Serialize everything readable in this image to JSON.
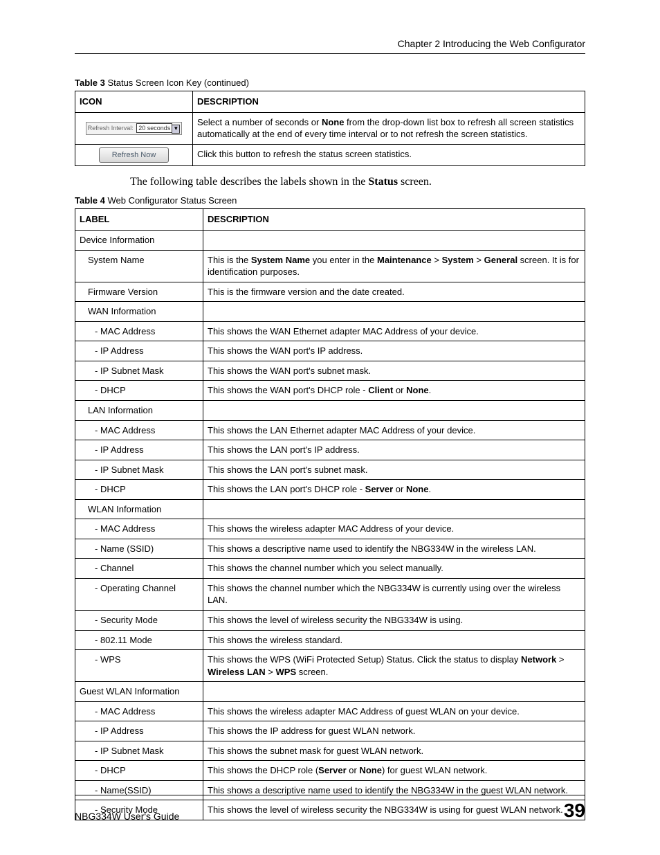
{
  "chapter_header": "Chapter 2 Introducing the Web Configurator",
  "table3": {
    "caption_prefix": "Table 3",
    "caption_body": "   Status Screen Icon Key  (continued)",
    "head_icon": "ICON",
    "head_desc": "DESCRIPTION",
    "refresh_interval_label": "Refresh Interval:",
    "refresh_interval_value": "20 seconds",
    "row1_desc_1": "Select a number of seconds or ",
    "row1_desc_bold": "None",
    "row1_desc_2": " from the drop-down list box to refresh all screen statistics automatically at the end of every time interval or to not refresh the screen statistics.",
    "refresh_now_label": "Refresh Now",
    "row2_desc": "Click this button to refresh the status screen statistics."
  },
  "intro_1": "The following table describes the labels shown in the ",
  "intro_bold": "Status",
  "intro_2": " screen.",
  "table4": {
    "caption_prefix": "Table 4",
    "caption_body": "   Web Configurator Status Screen",
    "head_label": "LABEL",
    "head_desc": "DESCRIPTION",
    "r1_l": "Device Information",
    "r1_d": "",
    "r2_l": "System Name",
    "r2_d_1": "This is the ",
    "r2_d_b1": "System Name",
    "r2_d_2": " you enter in the ",
    "r2_d_b2": "Maintenance",
    "r2_gt": " > ",
    "r2_d_b3": "System",
    "r2_d_b4": "General",
    "r2_d_3": " screen. It is for identification purposes.",
    "r3_l": "Firmware Version",
    "r3_d": "This is the firmware version and the date created.",
    "r4_l": "WAN Information",
    "r4_d": "",
    "r5_l": "- MAC Address",
    "r5_d": "This shows the WAN Ethernet adapter MAC Address of your device.",
    "r6_l": "- IP Address",
    "r6_d": "This shows the WAN port's IP address.",
    "r7_l": "- IP Subnet Mask",
    "r7_d": "This shows the WAN port's subnet mask.",
    "r8_l": "- DHCP",
    "r8_d_1": "This shows the WAN port's DHCP role - ",
    "r8_d_b1": "Client",
    "r8_d_2": " or ",
    "r8_d_b2": "None",
    "r8_d_3": ".",
    "r9_l": "LAN Information",
    "r9_d": "",
    "r10_l": "- MAC Address",
    "r10_d": "This shows the LAN Ethernet adapter MAC Address of your device.",
    "r11_l": "- IP Address",
    "r11_d": "This shows the LAN port's IP address.",
    "r12_l": "- IP Subnet Mask",
    "r12_d": "This shows the LAN port's subnet mask.",
    "r13_l": "- DHCP",
    "r13_d_1": "This shows the LAN port's DHCP role - ",
    "r13_d_b1": "Server",
    "r13_d_2": " or ",
    "r13_d_b2": "None",
    "r13_d_3": ".",
    "r14_l": "WLAN Information",
    "r14_d": "",
    "r15_l": "- MAC Address",
    "r15_d": "This shows the wireless adapter MAC Address of your device.",
    "r16_l": "- Name (SSID)",
    "r16_d": "This shows a descriptive name used to identify the NBG334W in the wireless LAN.",
    "r17_l": "- Channel",
    "r17_d": "This shows the channel number which you select manually.",
    "r18_l": "- Operating Channel",
    "r18_d": "This shows the channel number which the NBG334W is currently using over the wireless LAN.",
    "r19_l": "- Security Mode",
    "r19_d": "This shows the level of wireless security the NBG334W is using.",
    "r20_l": "- 802.11 Mode",
    "r20_d": "This shows the wireless standard.",
    "r21_l": "- WPS",
    "r21_d_1": "This shows the WPS (WiFi Protected Setup) Status. Click the status to display ",
    "r21_d_b1": "Network",
    "r21_gt": " > ",
    "r21_d_b2": "Wireless LAN",
    "r21_d_b3": "WPS",
    "r21_d_2": " screen.",
    "r22_l": "Guest WLAN Information",
    "r22_d": "",
    "r23_l": "- MAC Address",
    "r23_d": "This shows the wireless adapter MAC Address of guest WLAN on your device.",
    "r24_l": "- IP Address",
    "r24_d": "This shows the IP address for guest WLAN network.",
    "r25_l": "- IP Subnet Mask",
    "r25_d": "This shows the subnet mask for guest WLAN network.",
    "r26_l": "- DHCP",
    "r26_d_1": "This shows the DHCP role (",
    "r26_d_b1": "Server",
    "r26_d_2": " or ",
    "r26_d_b2": "None",
    "r26_d_3": ") for guest WLAN network.",
    "r27_l": "- Name(SSID)",
    "r27_d": "This shows a descriptive name used to identify the NBG334W in the guest WLAN network.",
    "r28_l": "- Security Mode",
    "r28_d": "This shows the level of wireless security the NBG334W is using for guest WLAN network."
  },
  "footer_left": "NBG334W User's Guide",
  "footer_right": "39"
}
